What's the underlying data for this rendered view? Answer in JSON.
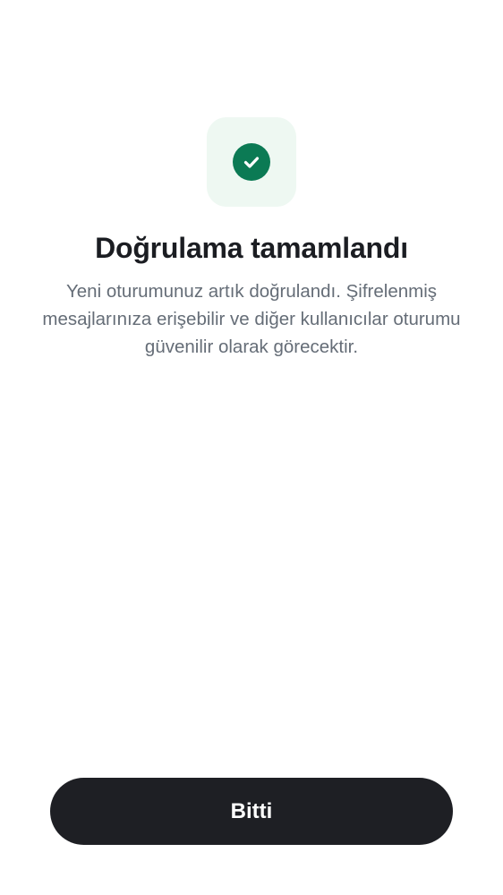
{
  "verification": {
    "icon": "check-circle-icon",
    "title": "Doğrulama tamamlandı",
    "description": "Yeni oturumunuz artık doğrulandı. Şifrelenmiş mesajlarınıza erişebilir ve diğer kullanıcılar oturumu güvenilir olarak görecektir."
  },
  "actions": {
    "done_label": "Bitti"
  },
  "colors": {
    "success_green": "#0b7a54",
    "icon_tile_bg": "#eef8f2",
    "button_bg": "#1e1f24",
    "title_text": "#1b1d22",
    "body_text": "#656d77"
  }
}
